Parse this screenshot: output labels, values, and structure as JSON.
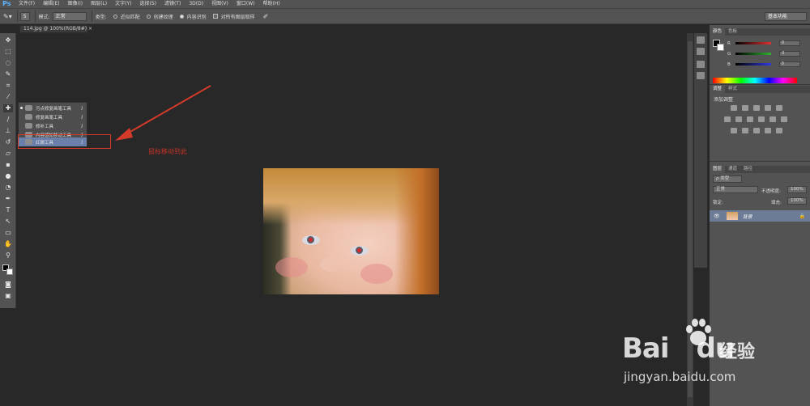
{
  "menubar": {
    "logo": "Ps",
    "items": [
      "文件(F)",
      "编辑(E)",
      "图像(I)",
      "图层(L)",
      "文字(Y)",
      "选择(S)",
      "滤镜(T)",
      "3D(D)",
      "视图(V)",
      "窗口(W)",
      "帮助(H)"
    ]
  },
  "options": {
    "brush_size": "5",
    "mode_label": "模式:",
    "mode_value": "正常",
    "type_label": "类型:",
    "radio1": "近似匹配",
    "radio2": "创建纹理",
    "radio3": "内容识别",
    "check_label": "对所有图层取样",
    "workspace": "基本功能"
  },
  "document": {
    "tab_title": "114.jpg @ 100%(RGB/8#)"
  },
  "flyout": {
    "items": [
      {
        "label": "污点修复画笔工具",
        "key": "J"
      },
      {
        "label": "修复画笔工具",
        "key": "J"
      },
      {
        "label": "修补工具",
        "key": "J"
      },
      {
        "label": "内容感知移动工具",
        "key": "J"
      },
      {
        "label": "红眼工具",
        "key": "J"
      }
    ]
  },
  "annotation": {
    "text": "鼠标移动到此",
    "color": "#c93529"
  },
  "panels": {
    "color_tabs": [
      "颜色",
      "色板"
    ],
    "rgb": [
      {
        "ch": "R",
        "value": "0",
        "color": "#d12a2a"
      },
      {
        "ch": "G",
        "value": "0",
        "color": "#2ea82e"
      },
      {
        "ch": "B",
        "value": "0",
        "color": "#2a3ad1"
      }
    ],
    "adj_tabs": [
      "调整",
      "样式"
    ],
    "adj_title": "添加调整",
    "layer_tabs": [
      "图层",
      "通道",
      "路径"
    ],
    "layer_kind": "ρ 类型",
    "blend": "正常",
    "opacity_label": "不透明度:",
    "opacity": "100%",
    "lock_label": "锁定:",
    "fill_label": "填充:",
    "fill": "100%",
    "layer_name": "背景"
  },
  "watermark": {
    "bai": "Bai",
    "du": "du",
    "jingyan": "经验",
    "url": "jingyan.baidu.com"
  }
}
